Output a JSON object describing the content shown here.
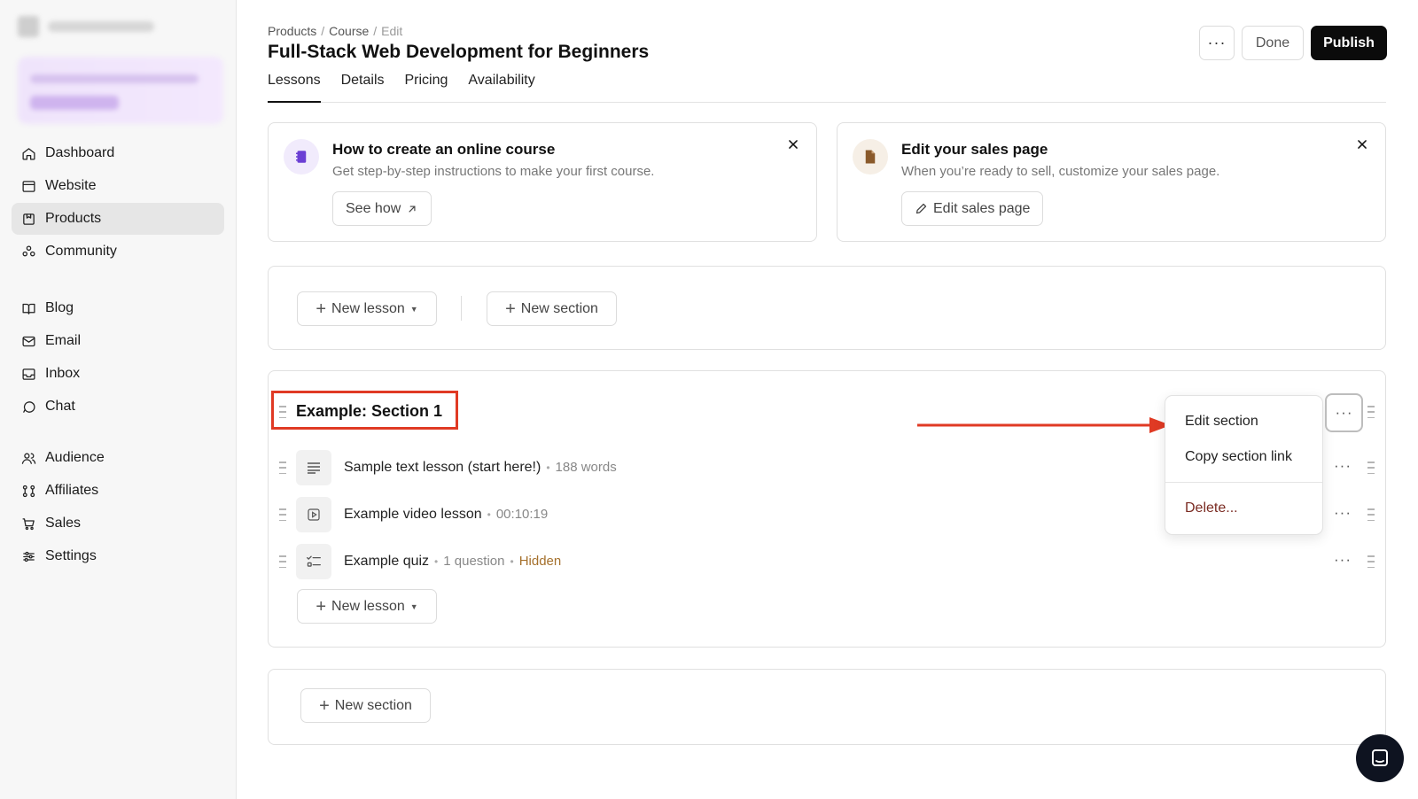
{
  "breadcrumb": {
    "products": "Products",
    "sep1": "/",
    "course": "Course",
    "sep2": "/",
    "edit": "Edit"
  },
  "page_title": "Full-Stack Web Development for Beginners",
  "header": {
    "more_label": "···",
    "done_label": "Done",
    "publish_label": "Publish"
  },
  "tabs": [
    {
      "label": "Lessons",
      "active": true
    },
    {
      "label": "Details"
    },
    {
      "label": "Pricing"
    },
    {
      "label": "Availability"
    }
  ],
  "sidebar": {
    "items": [
      {
        "label": "Dashboard",
        "icon": "home-icon"
      },
      {
        "label": "Website",
        "icon": "browser-icon"
      },
      {
        "label": "Products",
        "icon": "products-icon",
        "active": true
      },
      {
        "label": "Community",
        "icon": "community-icon"
      },
      {
        "label": "Blog",
        "icon": "book-icon"
      },
      {
        "label": "Email",
        "icon": "mail-icon"
      },
      {
        "label": "Inbox",
        "icon": "inbox-icon"
      },
      {
        "label": "Chat",
        "icon": "chat-bubble-icon"
      },
      {
        "label": "Audience",
        "icon": "users-icon"
      },
      {
        "label": "Affiliates",
        "icon": "affiliates-icon"
      },
      {
        "label": "Sales",
        "icon": "cart-icon"
      },
      {
        "label": "Settings",
        "icon": "sliders-icon"
      }
    ]
  },
  "cards": {
    "course_guide": {
      "title": "How to create an online course",
      "desc": "Get step-by-step instructions to make your first course.",
      "action": "See how",
      "accent": "#6b3fd4"
    },
    "sales_page": {
      "title": "Edit your sales page",
      "desc": "When you’re ready to sell, customize your sales page.",
      "action": "Edit sales page",
      "accent": "#8a5a2b"
    }
  },
  "actions": {
    "new_lesson": "New lesson",
    "new_section": "New section"
  },
  "section": {
    "title": "Example: Section 1",
    "lessons": [
      {
        "name": "Sample text lesson (start here!)",
        "meta": "188 words",
        "icon": "text-lines-icon"
      },
      {
        "name": "Example video lesson",
        "meta": "00:10:19",
        "icon": "video-play-icon"
      },
      {
        "name": "Example quiz",
        "meta": "1 question",
        "tag": "Hidden",
        "icon": "quiz-icon"
      }
    ],
    "new_lesson": "New lesson"
  },
  "bottom": {
    "new_section": "New section"
  },
  "dropdown": {
    "edit": "Edit section",
    "copy": "Copy section link",
    "delete": "Delete..."
  },
  "colors": {
    "highlight": "#e03a24",
    "hidden_tag": "#a5702c",
    "publish_bg": "#0b0b0b"
  }
}
